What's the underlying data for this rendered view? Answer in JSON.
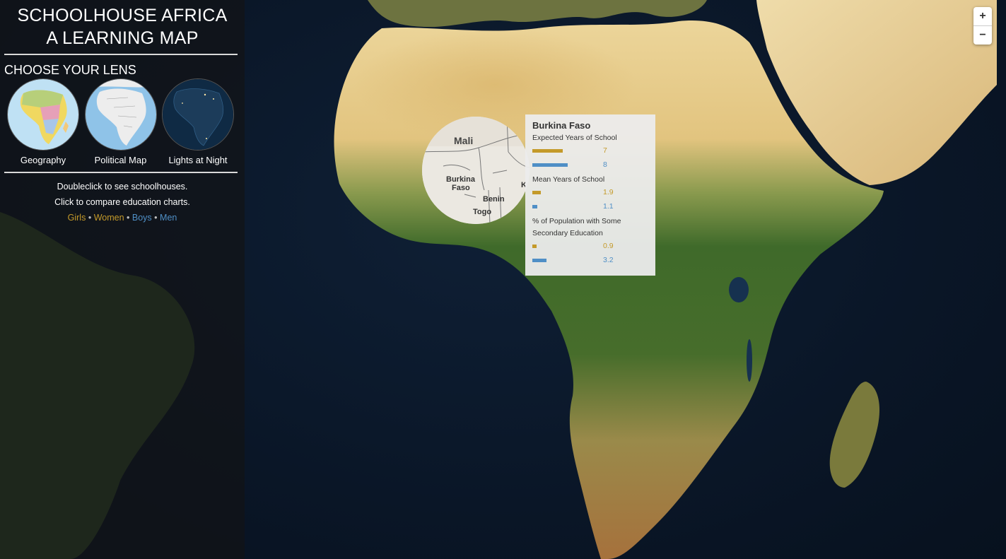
{
  "app": {
    "title_line1": "SCHOOLHOUSE AFRICA",
    "title_line2": "A LEARNING MAP"
  },
  "lens": {
    "heading": "CHOOSE YOUR LENS",
    "options": [
      {
        "label": "Geography"
      },
      {
        "label": "Political Map"
      },
      {
        "label": "Lights at Night"
      }
    ]
  },
  "instructions": {
    "line1": "Doubleclick to see schoolhouses.",
    "line2": "Click to compare education charts."
  },
  "legend": {
    "girls": "Girls",
    "women": "Women",
    "boys": "Boys",
    "men": "Men",
    "separator": "•"
  },
  "colors": {
    "female": "#c49a2a",
    "male": "#4f8fc6"
  },
  "zoom": {
    "in": "+",
    "out": "−"
  },
  "magnifier": {
    "labels": [
      "Mali",
      "Burkina",
      "Faso",
      "Benin",
      "Togo",
      "Ka"
    ]
  },
  "popup": {
    "country": "Burkina Faso",
    "metrics": [
      {
        "label": "Expected Years of School",
        "female": "7",
        "male": "8",
        "female_value": 7,
        "male_value": 8
      },
      {
        "label": "Mean Years of School",
        "female": "1.9",
        "male": "1.1",
        "female_value": 1.9,
        "male_value": 1.1
      },
      {
        "label": "% of Population with Some Secondary Education",
        "female": "0.9",
        "male": "3.2",
        "female_value": 0.9,
        "male_value": 3.2
      }
    ]
  }
}
